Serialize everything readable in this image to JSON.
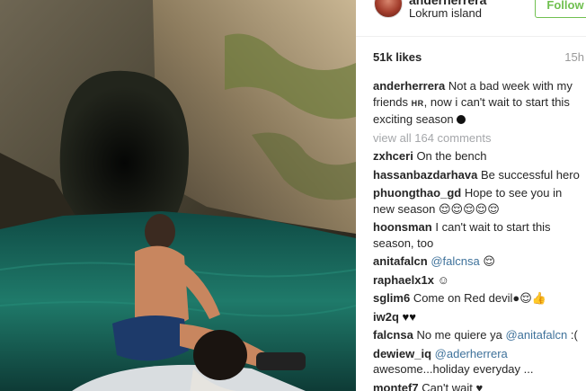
{
  "post": {
    "username": "anderherrera",
    "location": "Lokrum island",
    "follow_label": "Follow",
    "likes": "51k likes",
    "time": "15h",
    "caption_user": "anderherrera",
    "caption_text_1": "Not a bad week with my friends",
    "caption_tag": "HR",
    "caption_text_2": ", now i can't wait to start this exciting season",
    "caption_emoji": "●",
    "view_all": "view all 164 comments"
  },
  "comments": [
    {
      "user": "zxhceri",
      "text": "On the bench"
    },
    {
      "user": "hassanbazdarhava",
      "text": "Be successful hero"
    },
    {
      "user": "phuongthao_gd",
      "text": "Hope to see you in new season 😌😌😌😌😌"
    },
    {
      "user": "hoonsman",
      "text": "I can't wait to start this season, too"
    },
    {
      "user": "anitafalcn",
      "mention": "@falcnsa",
      "text": " 😌"
    },
    {
      "user": "raphaelx1x",
      "text": "☺"
    },
    {
      "user": "sglim6",
      "text": "Come on Red devil●😌👍"
    },
    {
      "user": "iw2q",
      "text": "♥♥"
    },
    {
      "user": "falcnsa",
      "text": "No me quiere ya ",
      "mention": "@anitafalcn",
      "text_after": " :("
    },
    {
      "user": "dewiew_iq",
      "mention": "@aderherrera",
      "text": "awesome...holiday everyday ..."
    },
    {
      "user": "montef7",
      "text": "Can't wait ♥"
    }
  ],
  "colors": {
    "follow_green": "#70c050",
    "mention_blue": "#3f729b",
    "muted_gray": "#a5a7aa"
  }
}
